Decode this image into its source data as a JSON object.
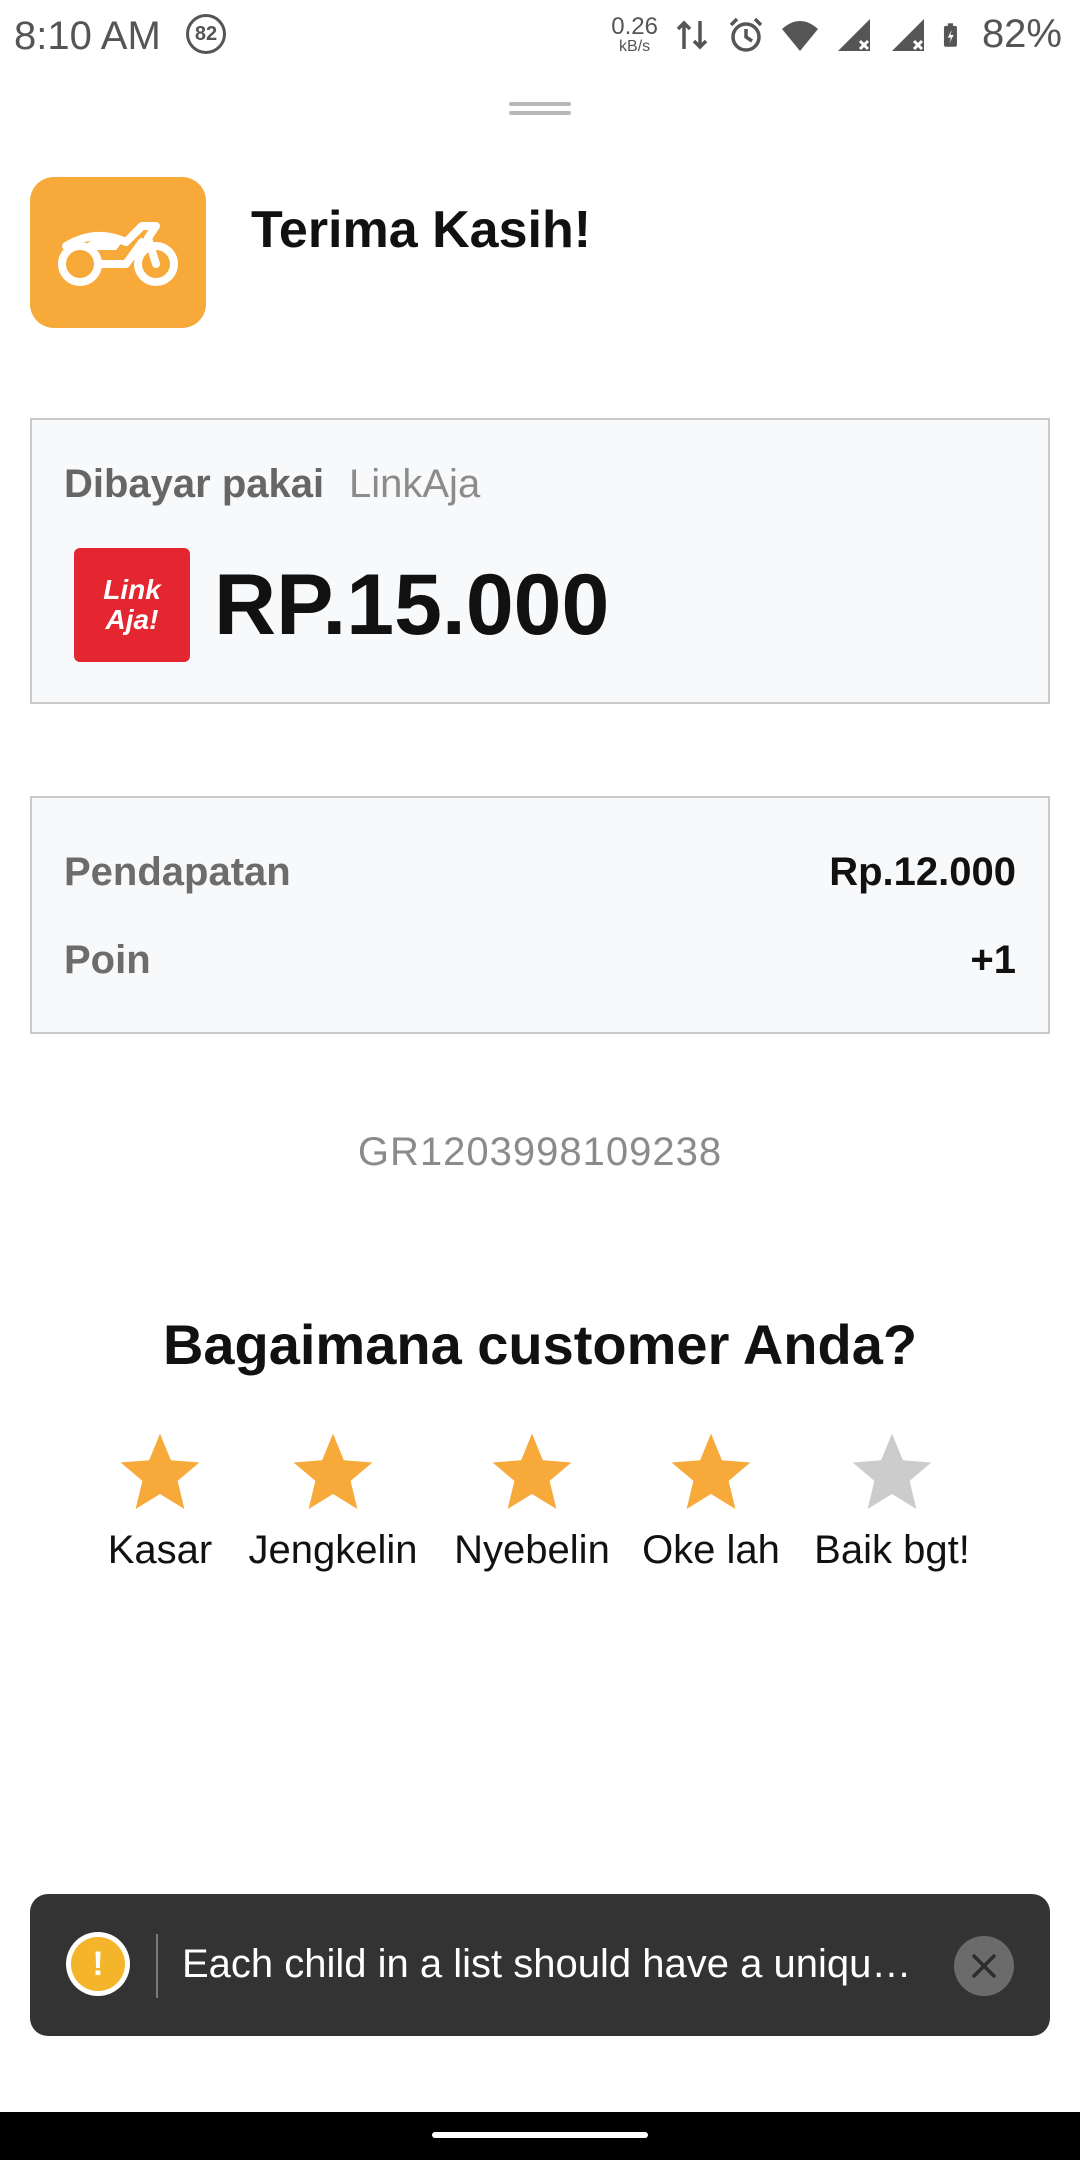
{
  "status_bar": {
    "time": "8:10 AM",
    "notification_count": "82",
    "net_speed_value": "0.26",
    "net_speed_unit": "kB/s",
    "battery_percent": "82%"
  },
  "header": {
    "title": "Terima Kasih!",
    "service_icon": "motorbike-icon",
    "service_color": "#f7a93a"
  },
  "payment": {
    "label": "Dibayar pakai",
    "method": "LinkAja",
    "logo_text_line1": "Link",
    "logo_text_line2": "Aja!",
    "amount": "RP.15.000"
  },
  "earnings": {
    "rows": [
      {
        "label": "Pendapatan",
        "value": "Rp.12.000"
      },
      {
        "label": "Poin",
        "value": "+1"
      }
    ]
  },
  "order_id": "GR1203998109238",
  "rating": {
    "question": "Bagaimana customer Anda?",
    "stars": [
      {
        "label": "Kasar",
        "filled": true
      },
      {
        "label": "Jengkelin",
        "filled": true
      },
      {
        "label": "Nyebelin",
        "filled": true
      },
      {
        "label": "Oke lah",
        "filled": true
      },
      {
        "label": "Baik bgt!",
        "filled": false
      }
    ],
    "selected": 4,
    "filled_color": "#f7a93a",
    "empty_color": "#cccccc"
  },
  "toast": {
    "message": "Each child in a list should have a uniqu…",
    "icon": "warning-icon"
  }
}
